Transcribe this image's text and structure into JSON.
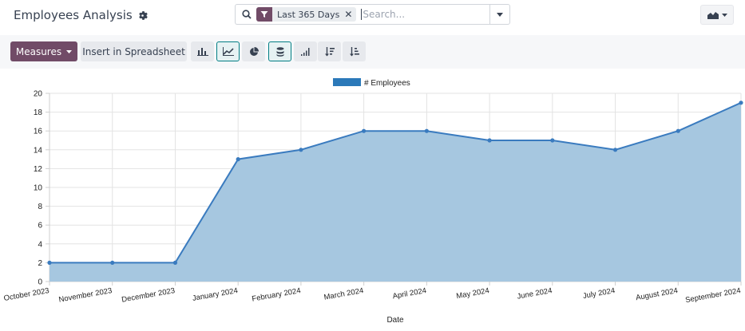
{
  "header": {
    "title": "Employees Analysis"
  },
  "search": {
    "facet_label": "Last 365 Days",
    "placeholder": "Search..."
  },
  "toolbar": {
    "measures_label": "Measures",
    "insert_label": "Insert in Spreadsheet"
  },
  "colors": {
    "brand": "#714b67",
    "active": "#017e84",
    "series_line": "#3a7bbf",
    "series_fill": "#a6c7e0"
  },
  "chart_data": {
    "type": "line",
    "stacked_area": true,
    "categories": [
      "October 2023",
      "November 2023",
      "December 2023",
      "January 2024",
      "February 2024",
      "March 2024",
      "April 2024",
      "May 2024",
      "June 2024",
      "July 2024",
      "August 2024",
      "September 2024"
    ],
    "series": [
      {
        "name": "# Employees",
        "values": [
          2,
          2,
          2,
          13,
          14,
          16,
          16,
          15,
          15,
          14,
          16,
          19
        ]
      }
    ],
    "xlabel": "Date",
    "ylabel": "",
    "ylim": [
      0,
      20
    ],
    "yticks": [
      "0",
      "2",
      "4",
      "6",
      "8",
      "10",
      "12",
      "14",
      "16",
      "18",
      "20"
    ],
    "grid": true,
    "legend_position": "top-center"
  }
}
